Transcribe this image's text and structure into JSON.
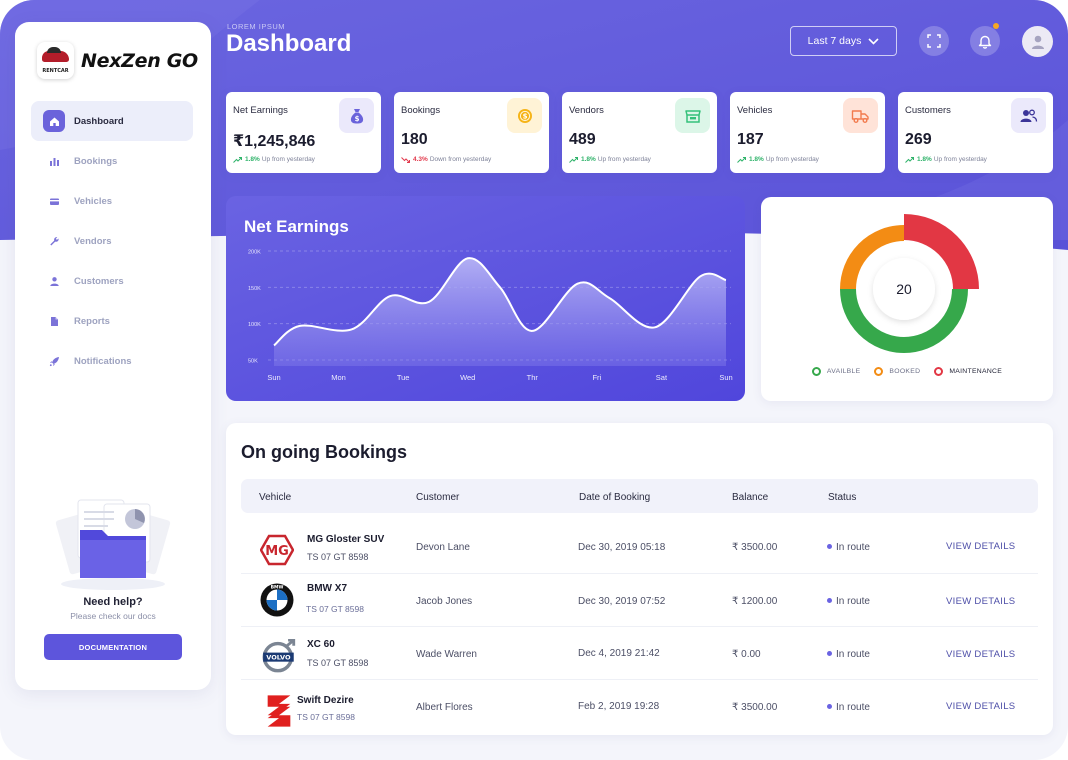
{
  "brand": {
    "badge_text": "RENTCAR",
    "name": "NexZen GO"
  },
  "header": {
    "eyebrow": "LOREM IPSUM",
    "title": "Dashboard",
    "range_label": "Last 7 days"
  },
  "sidebar": {
    "items": [
      {
        "label": "Dashboard",
        "icon": "home-icon"
      },
      {
        "label": "Bookings",
        "icon": "bar-chart-icon"
      },
      {
        "label": "Vehicles",
        "icon": "card-icon"
      },
      {
        "label": "Vendors",
        "icon": "wrench-icon"
      },
      {
        "label": "Customers",
        "icon": "user-icon"
      },
      {
        "label": "Reports",
        "icon": "file-icon"
      },
      {
        "label": "Notifications",
        "icon": "rocket-icon"
      }
    ],
    "help": {
      "title": "Need help?",
      "subtitle": "Please check our docs",
      "button": "DOCUMENTATION"
    }
  },
  "stats": [
    {
      "label": "Net Earnings",
      "value": "₹1,245,846",
      "pct": "1.8%",
      "note": "Up from yesterday",
      "trend": "up",
      "icon": "money-bag-icon",
      "icon_bg": "#ebe9fb",
      "icon_color": "#6a63db"
    },
    {
      "label": "Bookings",
      "value": "180",
      "pct": "4.3%",
      "note": "Down from yesterday",
      "trend": "down",
      "icon": "coin-icon",
      "icon_bg": "#fff3d6",
      "icon_color": "#f6b417"
    },
    {
      "label": "Vendors",
      "value": "489",
      "pct": "1.8%",
      "note": "Up from yesterday",
      "trend": "up",
      "icon": "store-icon",
      "icon_bg": "#dcf6e8",
      "icon_color": "#34c17a"
    },
    {
      "label": "Vehicles",
      "value": "187",
      "pct": "1.8%",
      "note": "Up from yesterday",
      "trend": "up",
      "icon": "truck-icon",
      "icon_bg": "#ffe3d8",
      "icon_color": "#f27b4e"
    },
    {
      "label": "Customers",
      "value": "269",
      "pct": "1.8%",
      "note": "Up from yesterday",
      "trend": "up",
      "icon": "users-icon",
      "icon_bg": "#ebe9fb",
      "icon_color": "#4a43b8"
    }
  ],
  "earnings": {
    "title": "Net Earnings"
  },
  "chart_data": [
    {
      "type": "area",
      "title": "Net Earnings",
      "categories": [
        "Sun",
        "Mon",
        "Tue",
        "Wed",
        "Thr",
        "Fri",
        "Sat",
        "Sun"
      ],
      "y_ticks": [
        "200K",
        "150K",
        "100K",
        "50K"
      ],
      "ylim": [
        50000,
        200000
      ],
      "points": [
        [
          0,
          70000
        ],
        [
          0.4,
          97000
        ],
        [
          1.2,
          92000
        ],
        [
          1.8,
          138000
        ],
        [
          2.4,
          130000
        ],
        [
          3,
          190000
        ],
        [
          3.5,
          150000
        ],
        [
          4,
          90000
        ],
        [
          4.7,
          155000
        ],
        [
          5.2,
          135000
        ],
        [
          5.9,
          95000
        ],
        [
          6.6,
          165000
        ],
        [
          7,
          160000
        ]
      ],
      "grid": true
    },
    {
      "type": "pie",
      "center_label": "20",
      "slices": [
        {
          "label": "AVAILBLE",
          "value": 50,
          "color": "#36a84b"
        },
        {
          "label": "BOOKED",
          "value": 25,
          "color": "#f38c14"
        },
        {
          "label": "MAINTENANCE",
          "value": 25,
          "color": "#e23744"
        }
      ]
    }
  ],
  "bookings": {
    "title": "On going Bookings",
    "columns": [
      "Vehicle",
      "Customer",
      "Date of Booking",
      "Balance",
      "Status"
    ],
    "action_label": "VIEW DETAILS",
    "rows": [
      {
        "vehicle": "MG Gloster SUV",
        "plate": "TS 07 GT 8598",
        "customer": "Devon Lane",
        "date": "Dec 30, 2019 05:18",
        "balance": "₹ 3500.00",
        "status": "In route",
        "logo": "mg-logo-icon"
      },
      {
        "vehicle": "BMW X7",
        "plate": "TS 07 GT 8598",
        "customer": "Jacob Jones",
        "date": "Dec 30, 2019 07:52",
        "balance": "₹ 1200.00",
        "status": "In route",
        "logo": "bmw-logo-icon"
      },
      {
        "vehicle": "XC 60",
        "plate": "TS 07 GT 8598",
        "customer": "Wade Warren",
        "date": "Dec 4, 2019 21:42",
        "balance": "₹ 0.00",
        "status": "In route",
        "logo": "volvo-logo-icon"
      },
      {
        "vehicle": "Swift Dezire",
        "plate": "TS 07 GT 8598",
        "customer": "Albert Flores",
        "date": "Feb 2, 2019 19:28",
        "balance": "₹ 3500.00",
        "status": "In route",
        "logo": "suzuki-logo-icon"
      }
    ]
  }
}
